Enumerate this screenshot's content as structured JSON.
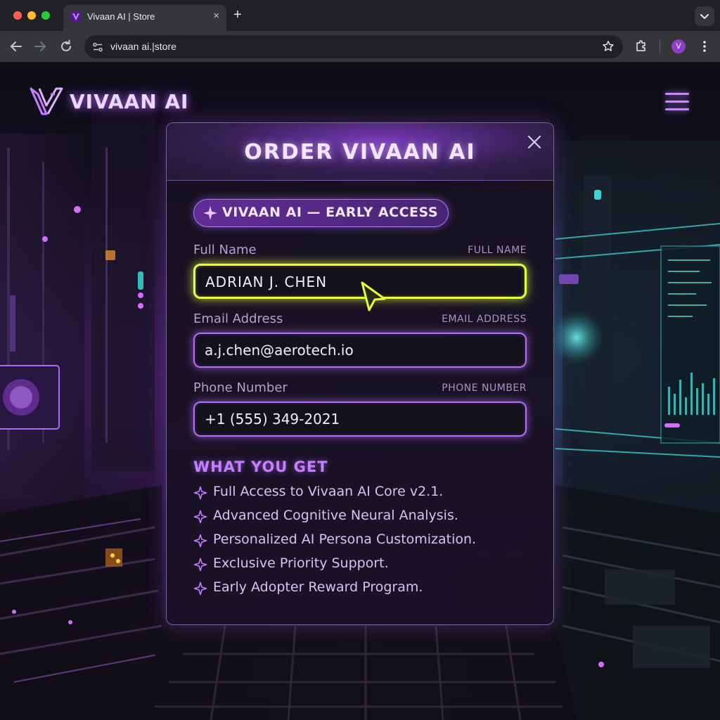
{
  "browser": {
    "tab_title": "Vivaan AI | Store",
    "tab_close": "×",
    "new_tab": "+",
    "url": "vivaan ai.|store",
    "profile_initial": "V"
  },
  "site": {
    "brand_name": "VIVAAN AI"
  },
  "modal": {
    "title": "ORDER VIVAAN AI",
    "badge": "VIVAAN AI — EARLY ACCESS",
    "fields": [
      {
        "label": "Full Name",
        "hint": "FULL NAME",
        "value": "ADRIAN J. CHEN"
      },
      {
        "label": "Email Address",
        "hint": "EMAIL ADDRESS",
        "value": "a.j.chen@aerotech.io"
      },
      {
        "label": "Phone Number",
        "hint": "PHONE NUMBER",
        "value": "+1 (555) 349-2021"
      }
    ],
    "benefits_title": "WHAT YOU GET",
    "benefits": [
      "Full Access to Vivaan AI Core v2.1.",
      "Advanced Cognitive Neural Analysis.",
      "Personalized AI Persona Customization.",
      "Exclusive Priority Support.",
      "Early Adopter Reward Program."
    ]
  },
  "colors": {
    "accent_purple": "#b86cff",
    "focus_yellow": "#e4ff3d",
    "teal_glow": "#3fd6d6"
  }
}
